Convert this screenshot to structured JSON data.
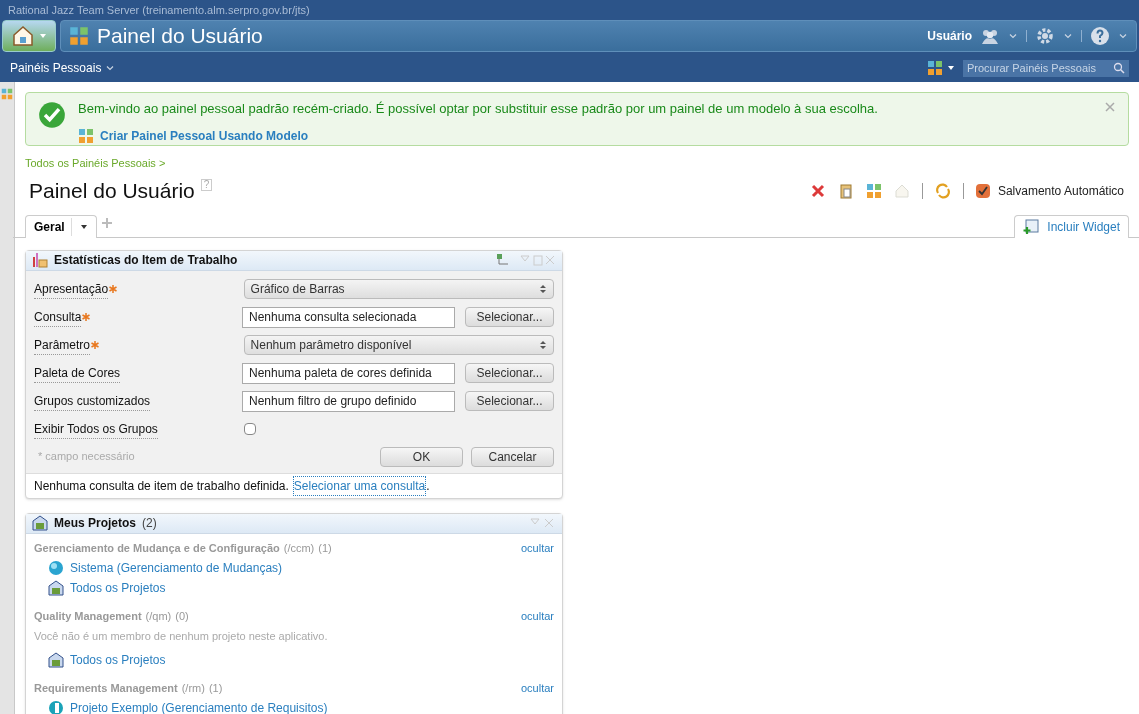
{
  "server_title": "Rational Jazz Team Server (treinamento.alm.serpro.gov.br/jts)",
  "app_title": "Painel do Usuário",
  "user_label": "Usuário",
  "nav": {
    "menu": "Painéis Pessoais",
    "search": {
      "placeholder": "Procurar Painéis Pessoais"
    }
  },
  "notice": {
    "message": "Bem-vindo ao painel pessoal padrão recém-criado. É possível optar por substituir esse padrão por um painel de um modelo à sua escolha.",
    "link": "Criar Painel Pessoal Usando Modelo"
  },
  "breadcrumb": "Todos os Painéis Pessoais >",
  "page_title": "Painel do Usuário",
  "help_mark": "?",
  "auto_save": {
    "label": "Salvamento Automático",
    "checked": true
  },
  "tabs": [
    {
      "label": "Geral",
      "selected": true
    }
  ],
  "add_widget": "Incluir Widget",
  "stats_widget": {
    "title": "Estatísticas do Item de Trabalho",
    "fields": [
      {
        "kind": "select",
        "label": "Apresentação",
        "required": true,
        "value": "Gráfico de Barras"
      },
      {
        "kind": "text",
        "label": "Consulta",
        "required": true,
        "value": "Nenhuma consulta selecionada",
        "button": "Selecionar..."
      },
      {
        "kind": "select",
        "label": "Parâmetro",
        "required": true,
        "value": "Nenhum parâmetro disponível"
      },
      {
        "kind": "text",
        "label": "Paleta de Cores",
        "required": false,
        "value": "Nenhuma paleta de cores definida",
        "button": "Selecionar..."
      },
      {
        "kind": "text",
        "label": "Grupos customizados",
        "required": false,
        "value": "Nenhum filtro de grupo definido",
        "button": "Selecionar..."
      },
      {
        "kind": "checkbox",
        "label": "Exibir Todos os Grupos",
        "required": false,
        "checked": false
      }
    ],
    "required_note": "* campo necessário",
    "ok": "OK",
    "cancel": "Cancelar",
    "footer_text": "Nenhuma consulta de item de trabalho definida.",
    "footer_link": "Selecionar uma consulta",
    "footer_end": "."
  },
  "projects_widget": {
    "title": "Meus Projetos",
    "count": "(2)",
    "groups": [
      {
        "name": "Gerenciamento de Mudança e de Configuração",
        "path": "(/ccm)",
        "count": "(1)",
        "hide": "ocultar",
        "items": [
          {
            "kind": "globe",
            "label": "Sistema (Gerenciamento de Mudanças)"
          },
          {
            "kind": "projects",
            "label": "Todos os Projetos"
          }
        ]
      },
      {
        "name": "Quality Management",
        "path": "(/qm)",
        "count": "(0)",
        "hide": "ocultar",
        "message": "Você não é um membro de nenhum projeto neste aplicativo.",
        "items": [
          {
            "kind": "projects",
            "label": "Todos os Projetos"
          }
        ]
      },
      {
        "name": "Requirements Management",
        "path": "(/rm)",
        "count": "(1)",
        "hide": "ocultar",
        "items": [
          {
            "kind": "requirement",
            "label": "Projeto Exemplo (Gerenciamento de Requisitos)"
          }
        ]
      }
    ]
  }
}
